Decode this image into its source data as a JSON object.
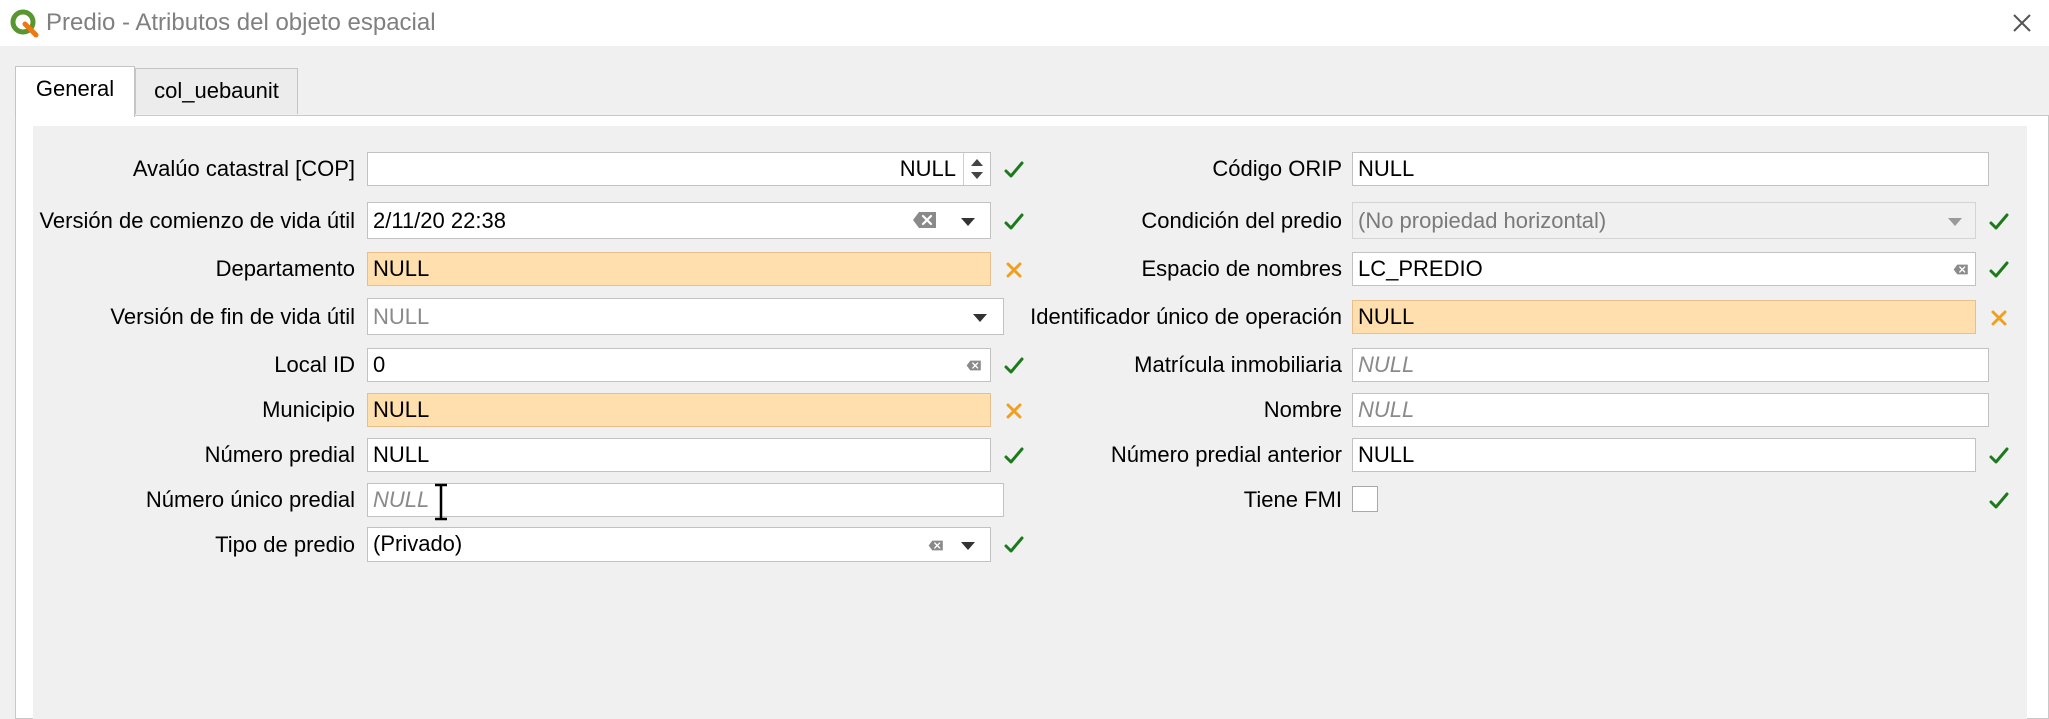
{
  "window": {
    "title": "Predio - Atributos del objeto espacial",
    "logo_icon": "qgis-logo-icon",
    "close_icon": "close-icon"
  },
  "tabs": [
    {
      "label": "General",
      "active": true
    },
    {
      "label": "col_uebaunit",
      "active": false
    }
  ],
  "colors": {
    "warning_field": "#ffdfad",
    "check_green": "#1c7a1c",
    "cross_orange": "#f0a020"
  },
  "left_fields": {
    "avaluo": {
      "label": "Avalúo catastral [COP]",
      "value": "NULL",
      "status": "valid"
    },
    "version_comienzo": {
      "label": "Versión de comienzo de vida útil",
      "value": "2/11/20 22:38",
      "status": "valid"
    },
    "departamento": {
      "label": "Departamento",
      "value": "NULL",
      "status": "invalid"
    },
    "version_fin": {
      "label": "Versión de fin de vida útil",
      "value": "NULL",
      "status": "none"
    },
    "local_id": {
      "label": "Local ID",
      "value": "0",
      "status": "valid"
    },
    "municipio": {
      "label": "Municipio",
      "value": "NULL",
      "status": "invalid"
    },
    "numero_predial": {
      "label": "Número predial",
      "value": "NULL",
      "status": "valid"
    },
    "numero_unico": {
      "label": "Número único predial",
      "placeholder": "NULL",
      "status": "none"
    },
    "tipo_predio": {
      "label": "Tipo de predio",
      "value": "(Privado)",
      "status": "valid"
    }
  },
  "right_fields": {
    "codigo_orip": {
      "label": "Código ORIP",
      "value": "NULL",
      "status": "none"
    },
    "condicion": {
      "label": "Condición del predio",
      "value": "(No propiedad horizontal)",
      "status": "valid"
    },
    "espacio_nombres": {
      "label": "Espacio de nombres",
      "value": "LC_PREDIO",
      "status": "valid"
    },
    "identificador": {
      "label": "Identificador único de operación",
      "value": "NULL",
      "status": "invalid"
    },
    "matricula": {
      "label": "Matrícula inmobiliaria",
      "placeholder": "NULL",
      "status": "none"
    },
    "nombre": {
      "label": "Nombre",
      "placeholder": "NULL",
      "status": "none"
    },
    "numero_anterior": {
      "label": "Número predial anterior",
      "value": "NULL",
      "status": "valid"
    },
    "tiene_fmi": {
      "label": "Tiene FMI",
      "checked": false,
      "status": "valid"
    }
  }
}
